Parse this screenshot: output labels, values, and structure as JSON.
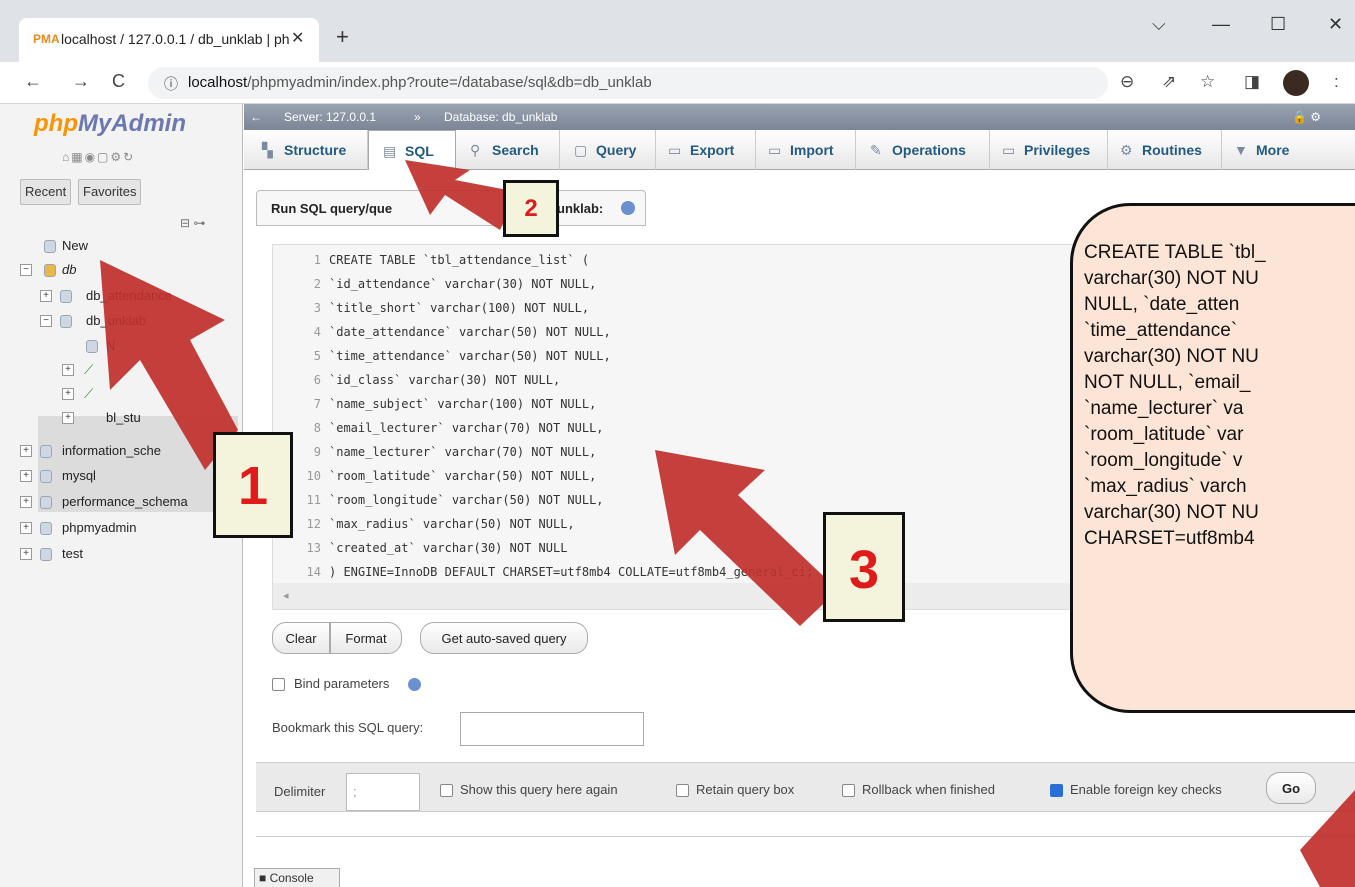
{
  "browser": {
    "tab_title": "localhost / 127.0.0.1 / db_unklab | ph",
    "tab_favicon": "PMA",
    "url_host": "localhost",
    "url_path": "/phpmyadmin/index.php?route=/database/sql&db=db_unklab",
    "window_controls": [
      "⌵",
      "—",
      "☐",
      "✕"
    ],
    "nav": {
      "back": "←",
      "forward": "→",
      "reload": "C",
      "new_tab": "+"
    },
    "addr_icons": [
      "⊖",
      "⇗",
      "☆",
      "◨",
      ":"
    ]
  },
  "sidebar": {
    "logo_php": "php",
    "logo_myadmin": "MyAdmin",
    "tabs": [
      "Recent",
      "Favorites"
    ],
    "tree": [
      {
        "label": "New",
        "exp": ""
      },
      {
        "label": "db",
        "exp": "−"
      },
      {
        "label": "db_attendance",
        "exp": "+"
      },
      {
        "label": "db_unklab",
        "exp": "−"
      },
      {
        "label": "N",
        "exp": ""
      },
      {
        "label": "",
        "exp": "+"
      },
      {
        "label": "",
        "exp": "+"
      },
      {
        "label": "bl_stu",
        "exp": "+"
      },
      {
        "label": "information_sche",
        "exp": "+"
      },
      {
        "label": "mysql",
        "exp": "+"
      },
      {
        "label": "performance_schema",
        "exp": "+"
      },
      {
        "label": "phpmyadmin",
        "exp": "+"
      },
      {
        "label": "test",
        "exp": "+"
      }
    ]
  },
  "breadcrumb": {
    "server": "Server: 127.0.0.1",
    "sep": "»",
    "database": "Database: db_unklab"
  },
  "menu_tabs": [
    "Structure",
    "SQL",
    "Search",
    "Query",
    "Export",
    "Import",
    "Operations",
    "Privileges",
    "Routines",
    "More"
  ],
  "panel": {
    "title": "Run SQL query/queries on database db_unklab:",
    "title_visible_left": "Run SQL query/que",
    "title_visible_right": "unklab:"
  },
  "editor": {
    "lines": [
      "CREATE TABLE `tbl_attendance_list` (",
      "  `id_attendance` varchar(30) NOT NULL,",
      "  `title_short` varchar(100) NOT NULL,",
      "  `date_attendance` varchar(50) NOT NULL,",
      "  `time_attendance` varchar(50) NOT NULL,",
      "  `id_class` varchar(30) NOT NULL,",
      "  `name_subject` varchar(100) NOT NULL,",
      "  `email_lecturer` varchar(70) NOT NULL,",
      "  `name_lecturer` varchar(70) NOT NULL,",
      "  `room_latitude` varchar(50) NOT NULL,",
      "  `room_longitude` varchar(50) NOT NULL,",
      "  `max_radius` varchar(50) NOT NULL,",
      "  `created_at` varchar(30) NOT NULL",
      ") ENGINE=InnoDB DEFAULT CHARSET=utf8mb4 COLLATE=utf8mb4_general_ci;"
    ],
    "scroll_arrow": "◂"
  },
  "buttons": {
    "clear": "Clear",
    "format": "Format",
    "autosaved": "Get auto-saved query",
    "go": "Go"
  },
  "options": {
    "bind_params": "Bind parameters",
    "bookmark": "Bookmark this SQL query:",
    "delimiter_label": "Delimiter",
    "delimiter_value": ";",
    "show_again": "Show this query here again",
    "retain": "Retain query box",
    "rollback": "Rollback when finished",
    "fk_checks": "Enable foreign key checks"
  },
  "console": "Console",
  "callout": {
    "lines": [
      "CREATE TABLE `tbl_",
      "varchar(30) NOT NU",
      "NULL, `date_atten",
      "`time_attendance`",
      "varchar(30) NOT NU",
      "NOT NULL, `email_",
      "`name_lecturer` va",
      "`room_latitude` var",
      "`room_longitude` v",
      "`max_radius` varch",
      "varchar(30) NOT NU",
      "CHARSET=utf8mb4"
    ]
  },
  "steps": [
    "1",
    "2",
    "3"
  ],
  "colors": {
    "accent_link": "#235a81",
    "callout_fill": "#fce4d6",
    "arrow_red": "#c0302c",
    "step_number": "#e01b1b"
  }
}
